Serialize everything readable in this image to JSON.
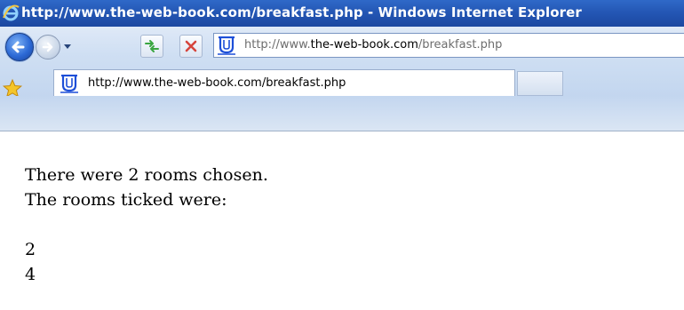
{
  "window": {
    "title": "http://www.the-web-book.com/breakfast.php - Windows Internet Explorer"
  },
  "address_bar": {
    "url_prefix": "http://www.",
    "url_domain": "the-web-book.com",
    "url_path": "/breakfast.php"
  },
  "tab": {
    "label": "http://www.the-web-book.com/breakfast.php"
  },
  "page": {
    "line1": "There were 2 rooms chosen.",
    "line2": "The rooms ticked were:",
    "rooms": [
      "2",
      "4"
    ]
  },
  "icons": {
    "browser": "ie-logo-icon",
    "back": "back-arrow-icon",
    "forward": "forward-arrow-icon",
    "refresh": "refresh-icon",
    "stop": "stop-icon",
    "site": "site-favicon-icon",
    "favorites": "favorites-star-icon"
  },
  "colors": {
    "titlebar": "#2457b5",
    "chrome": "#cfdff3",
    "stop": "#d6453d",
    "refresh": "#3aa641"
  }
}
